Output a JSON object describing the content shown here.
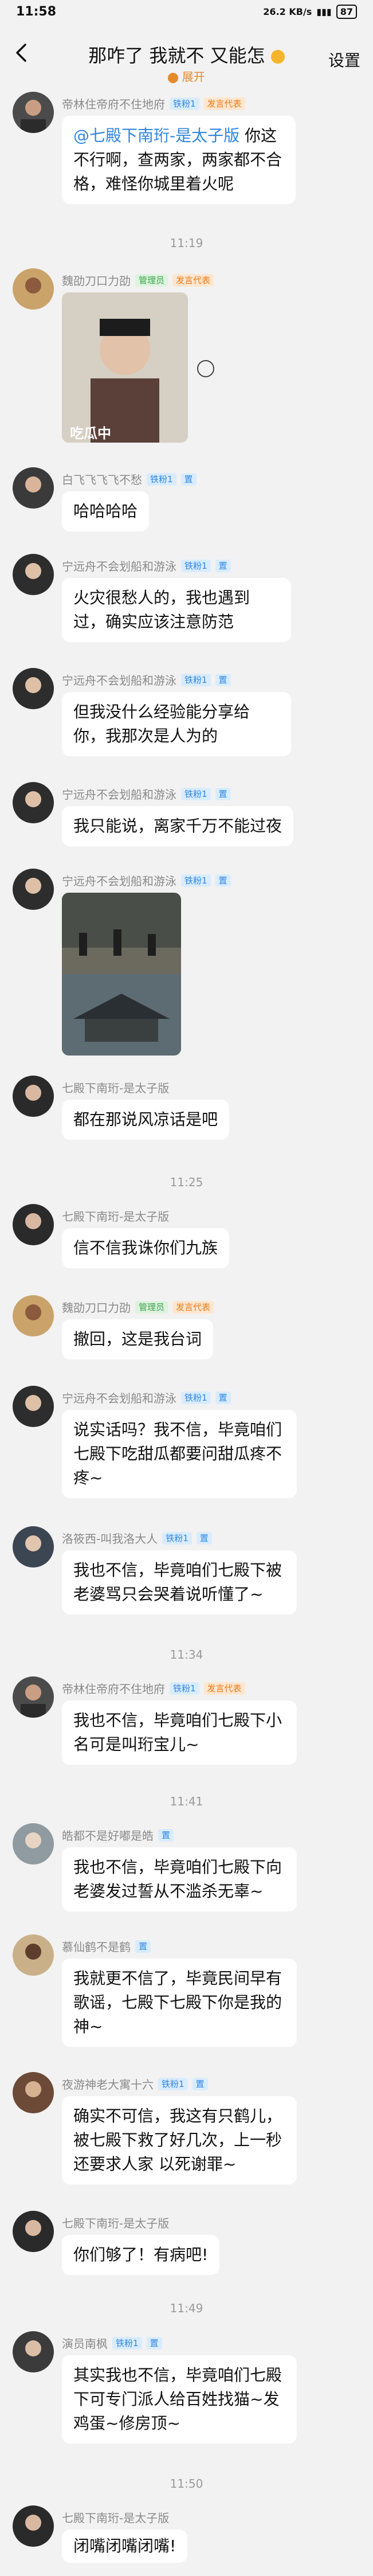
{
  "status": {
    "time": "11:58",
    "network": "26.2 KB/s",
    "battery": "87"
  },
  "header": {
    "title": "那咋了 我就不 又能怎",
    "subtitle": "展开",
    "settings": "设置"
  },
  "badges": {
    "level1": "铁粉1",
    "speaker": "发言代表",
    "admin": "管理员",
    "founder": "置"
  },
  "messages": [
    {
      "sender": "帝林住帝府不住地府",
      "text_mention": "@七殿下南珩-是太子版",
      "text": " 你这不行啊，查两家，两家都不合格，难怪你城里着火呢"
    },
    {
      "sender": "魏劭刀口力劭",
      "caption": "吃瓜中"
    },
    {
      "sender": "白飞飞飞飞不愁",
      "text": "哈哈哈哈"
    },
    {
      "sender": "宁远舟不会划船和游泳",
      "text": "火灾很愁人的，我也遇到过，确实应该注意防范"
    },
    {
      "sender": "宁远舟不会划船和游泳",
      "text": "但我没什么经验能分享给你，我那次是人为的"
    },
    {
      "sender": "宁远舟不会划船和游泳",
      "text": "我只能说，离家千万不能过夜"
    },
    {
      "sender": "宁远舟不会划船和游泳"
    },
    {
      "sender": "七殿下南珩-是太子版",
      "text": "都在那说风凉话是吧"
    },
    {
      "sender": "七殿下南珩-是太子版",
      "text": "信不信我诛你们九族"
    },
    {
      "sender": "魏劭刀口力劭",
      "text": "撤回，这是我台词"
    },
    {
      "sender": "宁远舟不会划船和游泳",
      "text": "说实话吗？我不信，毕竟咱们七殿下吃甜瓜都要问甜瓜疼不疼~"
    },
    {
      "sender": "洛筱西-叫我洛大人",
      "text": "我也不信，毕竟咱们七殿下被老婆骂只会哭着说听懂了~"
    },
    {
      "sender": "帝林住帝府不住地府",
      "text": "我也不信，毕竟咱们七殿下小名可是叫珩宝儿~"
    },
    {
      "sender": "皓都不是好嘟是皓",
      "text": "我也不信，毕竟咱们七殿下向老婆发过誓从不滥杀无辜~"
    },
    {
      "sender": "慕仙鹤不是鹤",
      "text": "我就更不信了，毕竟民间早有歌谣，七殿下七殿下你是我的神~"
    },
    {
      "sender": "夜游神老大寓十六",
      "text": "确实不可信，我这有只鹤儿，被七殿下救了好几次，上一秒还要求人家 以死谢罪~"
    },
    {
      "sender": "七殿下南珩-是太子版",
      "text": "你们够了！有病吧!"
    },
    {
      "sender": "演员南枫",
      "text": "其实我也不信，毕竟咱们七殿下可专门派人给百姓找猫~发鸡蛋~修房顶~"
    },
    {
      "sender": "七殿下南珩-是太子版",
      "text": "闭嘴闭嘴闭嘴!"
    }
  ],
  "timestamps": [
    "11:19",
    "11:25",
    "11:34",
    "11:41",
    "11:49",
    "11:50"
  ],
  "colors": {
    "background": "#f2f2f2",
    "bubble": "#ffffff",
    "mention": "#2f86e0",
    "subtitle": "#e38b2a"
  }
}
